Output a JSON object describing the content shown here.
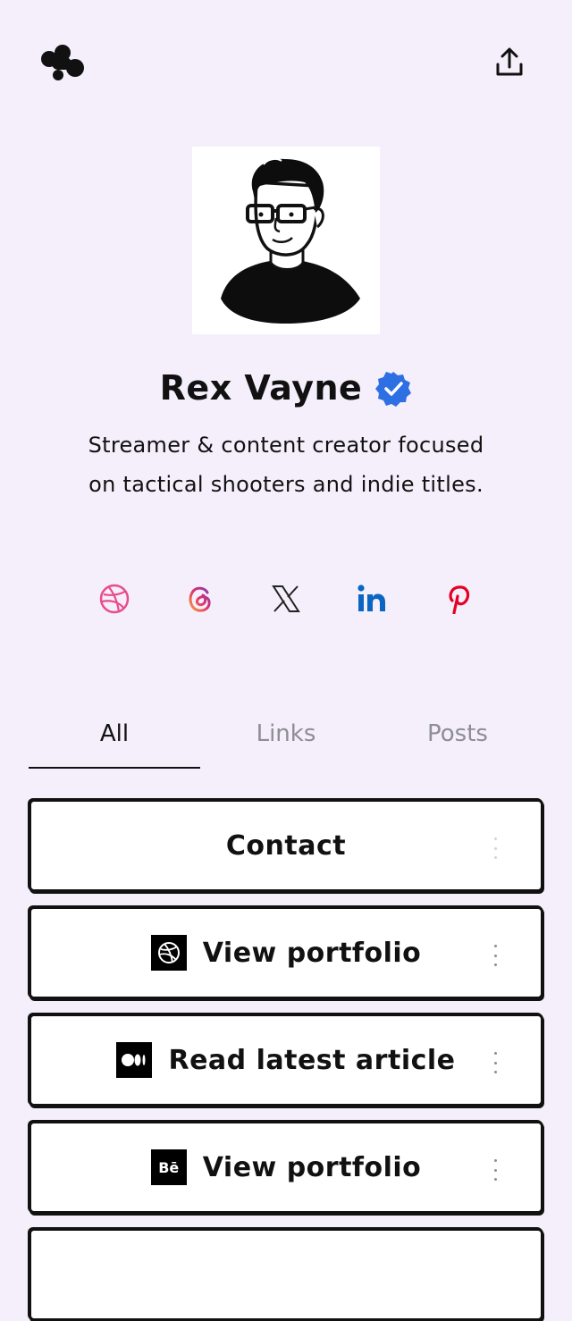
{
  "header": {
    "logo_icon": "blob-logo-icon",
    "share_icon": "share-upload-icon"
  },
  "profile": {
    "name": "Rex Vayne",
    "verified": true,
    "verified_color": "#2f6fe4",
    "bio_line1": "Streamer & content creator focused",
    "bio_line2": "on tactical shooters and indie titles."
  },
  "socials": [
    {
      "name": "dribbble",
      "icon": "dribbble-icon",
      "color": "#ea4c89"
    },
    {
      "name": "threads",
      "icon": "threads-icon",
      "color": "#c13584"
    },
    {
      "name": "x",
      "icon": "x-icon",
      "color": "#222222"
    },
    {
      "name": "linkedin",
      "icon": "linkedin-icon",
      "color": "#0a66c2"
    },
    {
      "name": "pinterest",
      "icon": "pinterest-icon",
      "color": "#e60023"
    }
  ],
  "tabs": [
    {
      "label": "All",
      "active": true
    },
    {
      "label": "Links",
      "active": false
    },
    {
      "label": "Posts",
      "active": false
    }
  ],
  "links": [
    {
      "label": "Contact",
      "icon": ""
    },
    {
      "label": "View portfolio",
      "icon": "dribbble-icon"
    },
    {
      "label": "Read latest article",
      "icon": "medium-icon"
    },
    {
      "label": "View portfolio",
      "icon": "behance-icon"
    }
  ],
  "behance_glyph": "Bē"
}
